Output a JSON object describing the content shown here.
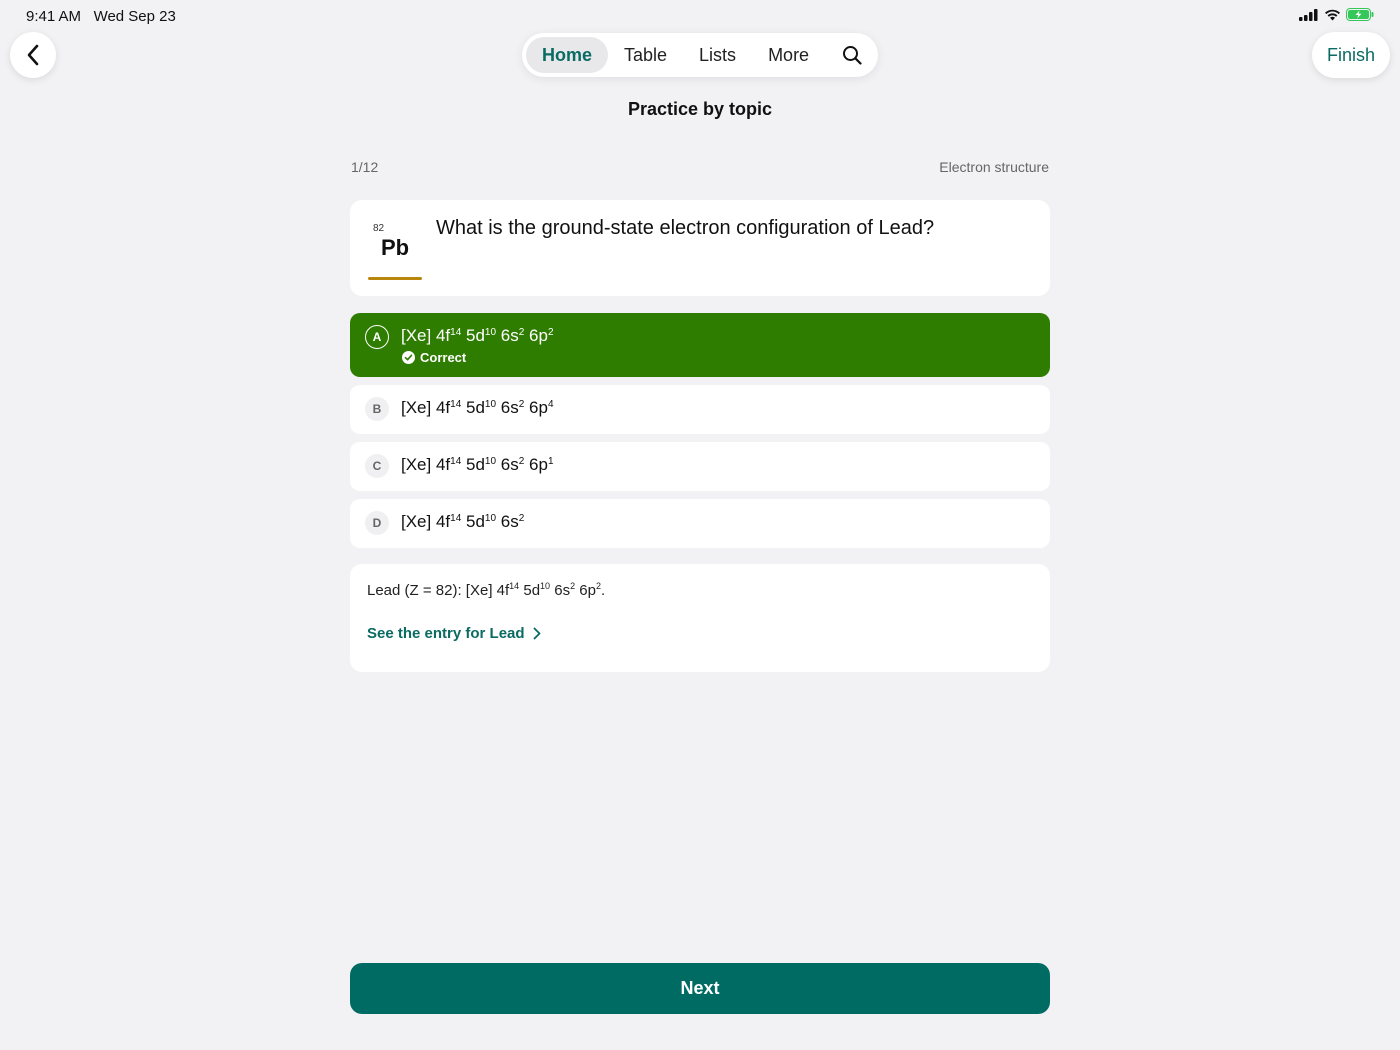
{
  "status": {
    "time": "9:41 AM",
    "date": "Wed Sep 23",
    "icons": [
      "cellular-signal-icon",
      "wifi-icon",
      "battery-charging-icon"
    ]
  },
  "nav": {
    "back_icon": "chevron-left-icon",
    "tabs": [
      {
        "label": "Home",
        "active": true
      },
      {
        "label": "Table",
        "active": false
      },
      {
        "label": "Lists",
        "active": false
      },
      {
        "label": "More",
        "active": false
      }
    ],
    "search_icon": "search-icon",
    "finish_label": "Finish"
  },
  "page": {
    "title": "Practice by topic",
    "progress": "1/12",
    "topic": "Electron structure"
  },
  "question": {
    "element_number": "82",
    "element_symbol": "Pb",
    "text": "What is the ground-state electron configuration of Lead?"
  },
  "options": [
    {
      "letter": "A",
      "core": "[Xe]",
      "f": "14",
      "d": "10",
      "s": "2",
      "p": "2",
      "correct": true,
      "feedback": "Correct"
    },
    {
      "letter": "B",
      "core": "[Xe]",
      "f": "14",
      "d": "10",
      "s": "2",
      "p": "4",
      "correct": false
    },
    {
      "letter": "C",
      "core": "[Xe]",
      "f": "14",
      "d": "10",
      "s": "2",
      "p": "1",
      "correct": false
    },
    {
      "letter": "D",
      "core": "[Xe]",
      "f": "14",
      "d": "10",
      "s": "2",
      "correct": false
    }
  ],
  "explanation": {
    "prefix": "Lead (Z = 82): [Xe] 4f",
    "f": "14",
    "d": "10",
    "s": "2",
    "p": "2",
    "link_label": "See the entry for Lead",
    "link_icon": "chevron-right-icon"
  },
  "next_label": "Next",
  "colors": {
    "accent": "#0a6b63",
    "correct": "#2e7d00",
    "element_underline": "#b8860b",
    "background": "#f2f2f4"
  }
}
